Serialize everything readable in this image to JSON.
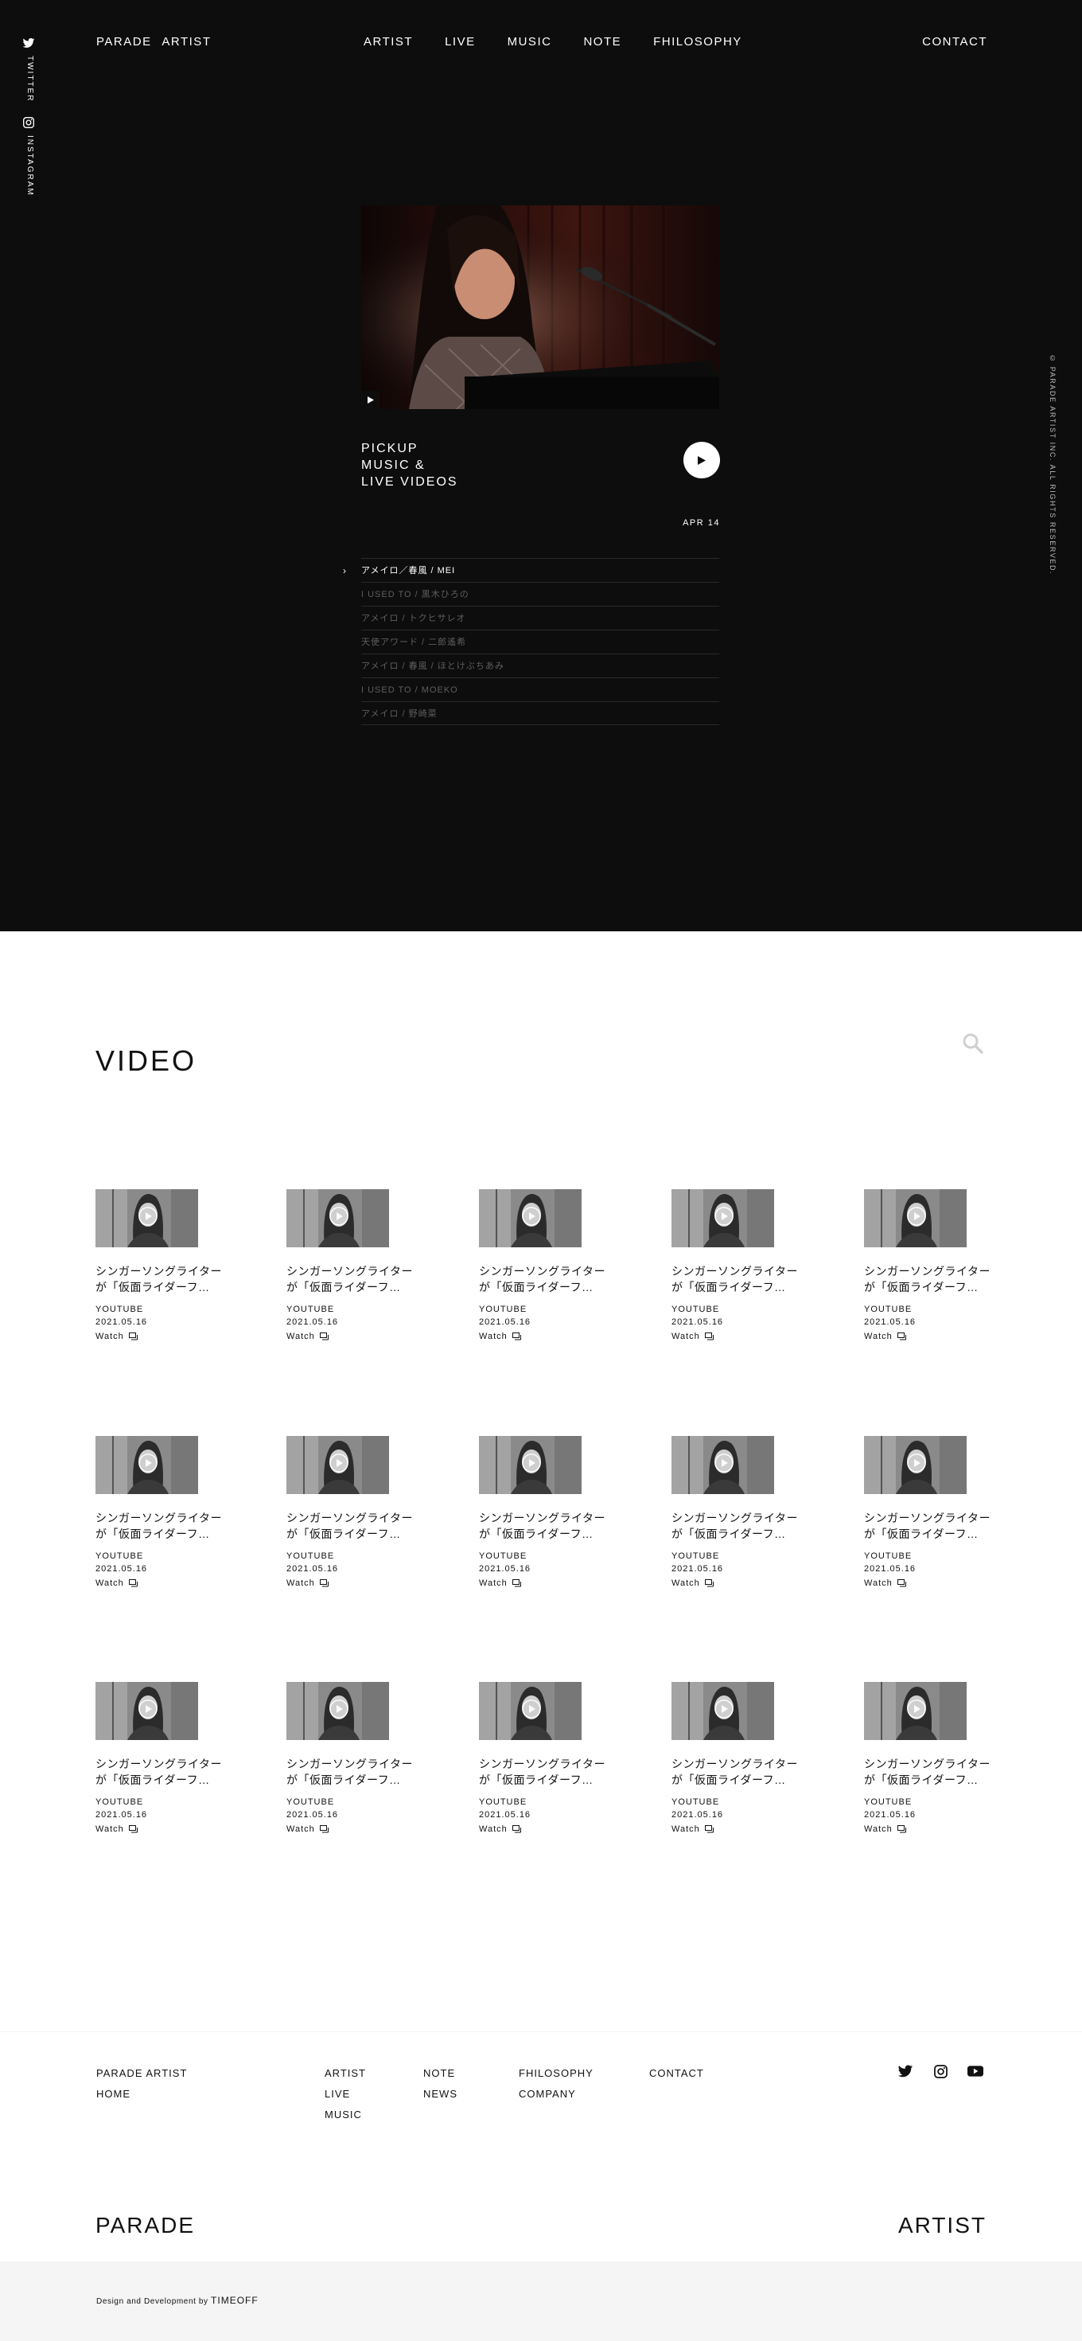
{
  "sidebar": {
    "twitter_label": "TWITTER",
    "instagram_label": "INSTAGRAM"
  },
  "header": {
    "brand": "PARADE ARTIST",
    "nav": [
      "ARTIST",
      "LIVE",
      "MUSIC",
      "NOTE",
      "FHILOSOPHY"
    ],
    "contact": "CONTACT"
  },
  "copyright": "© PARADE ARTIST INC. ALL RIGHTS RESERVED.",
  "pickup": {
    "title_lines": [
      "PICKUP",
      "MUSIC &",
      "LIVE VIDEOS"
    ],
    "date": "APR 14",
    "tracks": [
      {
        "label": "アメイロ／春風 / MEI",
        "active": true
      },
      {
        "label": "I USED TO / 黒木ひろの",
        "active": false
      },
      {
        "label": "アメイロ / トクヒサレオ",
        "active": false
      },
      {
        "label": "天使アワード / 二郎遙希",
        "active": false
      },
      {
        "label": "アメイロ / 春風 / ほとけぶちあみ",
        "active": false
      },
      {
        "label": "I USED TO / MOEKO",
        "active": false
      },
      {
        "label": "アメイロ / 野崎菜",
        "active": false
      }
    ]
  },
  "video_section": {
    "title": "VIDEO",
    "videos": [
      {
        "title_1": "シンガーソングライター",
        "title_2": "が「仮面ライダーフ…",
        "source": "YOUTUBE",
        "date": "2021.05.16",
        "watch": "Watch"
      },
      {
        "title_1": "シンガーソングライター",
        "title_2": "が「仮面ライダーフ…",
        "source": "YOUTUBE",
        "date": "2021.05.16",
        "watch": "Watch"
      },
      {
        "title_1": "シンガーソングライター",
        "title_2": "が「仮面ライダーフ…",
        "source": "YOUTUBE",
        "date": "2021.05.16",
        "watch": "Watch"
      },
      {
        "title_1": "シンガーソングライター",
        "title_2": "が「仮面ライダーフ…",
        "source": "YOUTUBE",
        "date": "2021.05.16",
        "watch": "Watch"
      },
      {
        "title_1": "シンガーソングライター",
        "title_2": "が「仮面ライダーフ…",
        "source": "YOUTUBE",
        "date": "2021.05.16",
        "watch": "Watch"
      },
      {
        "title_1": "シンガーソングライター",
        "title_2": "が「仮面ライダーフ…",
        "source": "YOUTUBE",
        "date": "2021.05.16",
        "watch": "Watch"
      },
      {
        "title_1": "シンガーソングライター",
        "title_2": "が「仮面ライダーフ…",
        "source": "YOUTUBE",
        "date": "2021.05.16",
        "watch": "Watch"
      },
      {
        "title_1": "シンガーソングライター",
        "title_2": "が「仮面ライダーフ…",
        "source": "YOUTUBE",
        "date": "2021.05.16",
        "watch": "Watch"
      },
      {
        "title_1": "シンガーソングライター",
        "title_2": "が「仮面ライダーフ…",
        "source": "YOUTUBE",
        "date": "2021.05.16",
        "watch": "Watch"
      },
      {
        "title_1": "シンガーソングライター",
        "title_2": "が「仮面ライダーフ…",
        "source": "YOUTUBE",
        "date": "2021.05.16",
        "watch": "Watch"
      },
      {
        "title_1": "シンガーソングライター",
        "title_2": "が「仮面ライダーフ…",
        "source": "YOUTUBE",
        "date": "2021.05.16",
        "watch": "Watch"
      },
      {
        "title_1": "シンガーソングライター",
        "title_2": "が「仮面ライダーフ…",
        "source": "YOUTUBE",
        "date": "2021.05.16",
        "watch": "Watch"
      },
      {
        "title_1": "シンガーソングライター",
        "title_2": "が「仮面ライダーフ…",
        "source": "YOUTUBE",
        "date": "2021.05.16",
        "watch": "Watch"
      },
      {
        "title_1": "シンガーソングライター",
        "title_2": "が「仮面ライダーフ…",
        "source": "YOUTUBE",
        "date": "2021.05.16",
        "watch": "Watch"
      },
      {
        "title_1": "シンガーソングライター",
        "title_2": "が「仮面ライダーフ…",
        "source": "YOUTUBE",
        "date": "2021.05.16",
        "watch": "Watch"
      }
    ]
  },
  "footer": {
    "col1": [
      "PARADE ARTIST",
      "HOME"
    ],
    "col2": [
      "ARTIST",
      "LIVE",
      "MUSIC"
    ],
    "col3": [
      "NOTE",
      "NEWS"
    ],
    "col4": [
      "FHILOSOPHY",
      "COMPANY"
    ],
    "col5": [
      "CONTACT"
    ],
    "social_icons": [
      "twitter-icon",
      "instagram-icon",
      "youtube-icon"
    ],
    "brand_left": "PARADE",
    "brand_right": "ARTIST",
    "credit_prefix": "Design and Development by",
    "credit_name": "TIMEOFF"
  },
  "colors": {
    "hero_bg": "#0d0d0d",
    "text_dark": "#111111",
    "inactive_track": "#5e5e5e",
    "credit_bg": "#f5f5f5"
  }
}
